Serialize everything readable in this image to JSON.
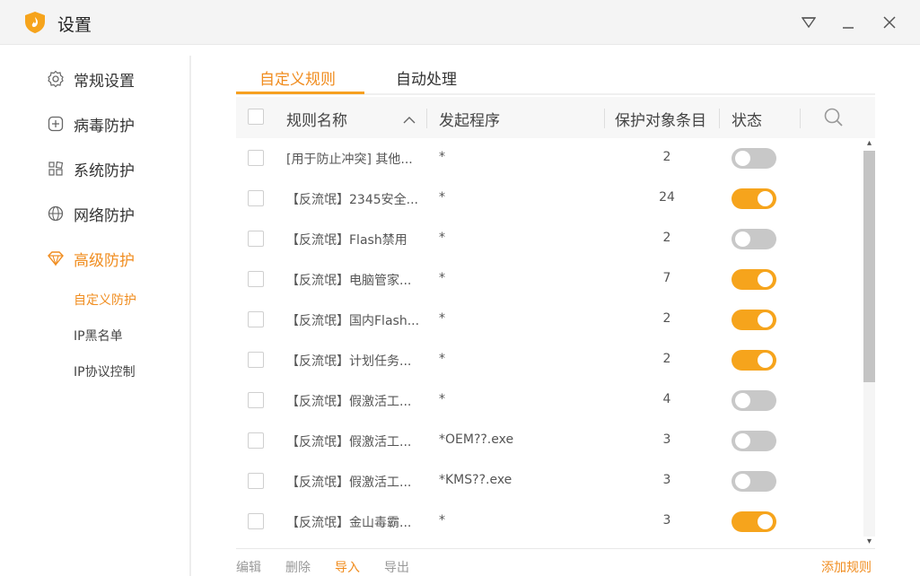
{
  "window": {
    "title": "设置"
  },
  "colors": {
    "accent": "#f08c1e",
    "toggle_on": "#f6a41c",
    "toggle_off": "#c8c8c8"
  },
  "sidebar": {
    "items": [
      {
        "label": "常规设置",
        "icon": "gear-icon"
      },
      {
        "label": "病毒防护",
        "icon": "plus-square-icon"
      },
      {
        "label": "系统防护",
        "icon": "blocks-icon"
      },
      {
        "label": "网络防护",
        "icon": "globe-icon"
      },
      {
        "label": "高级防护",
        "icon": "diamond-icon",
        "active": true
      }
    ],
    "subitems": [
      {
        "label": "自定义防护",
        "active": true
      },
      {
        "label": "IP黑名单"
      },
      {
        "label": "IP协议控制"
      }
    ]
  },
  "tabs": [
    {
      "label": "自定义规则",
      "active": true
    },
    {
      "label": "自动处理"
    }
  ],
  "table": {
    "columns": {
      "name": "规则名称",
      "program": "发起程序",
      "count": "保护对象条目",
      "status": "状态"
    },
    "rows": [
      {
        "name": "[用于防止冲突] 其他...",
        "program": "*",
        "count": "2",
        "enabled": false
      },
      {
        "name": "【反流氓】2345安全...",
        "program": "*",
        "count": "24",
        "enabled": true
      },
      {
        "name": "【反流氓】Flash禁用",
        "program": "*",
        "count": "2",
        "enabled": false
      },
      {
        "name": "【反流氓】电脑管家...",
        "program": "*",
        "count": "7",
        "enabled": true
      },
      {
        "name": "【反流氓】国内Flash...",
        "program": "*",
        "count": "2",
        "enabled": true
      },
      {
        "name": "【反流氓】计划任务...",
        "program": "*",
        "count": "2",
        "enabled": true
      },
      {
        "name": "【反流氓】假激活工...",
        "program": "*",
        "count": "4",
        "enabled": false
      },
      {
        "name": "【反流氓】假激活工...",
        "program": "*OEM??.exe",
        "count": "3",
        "enabled": false
      },
      {
        "name": "【反流氓】假激活工...",
        "program": "*KMS??.exe",
        "count": "3",
        "enabled": false
      },
      {
        "name": "【反流氓】金山毒霸...",
        "program": "*",
        "count": "3",
        "enabled": true
      }
    ]
  },
  "footer": {
    "edit": "编辑",
    "delete": "删除",
    "import": "导入",
    "export": "导出",
    "add_rule": "添加规则"
  }
}
